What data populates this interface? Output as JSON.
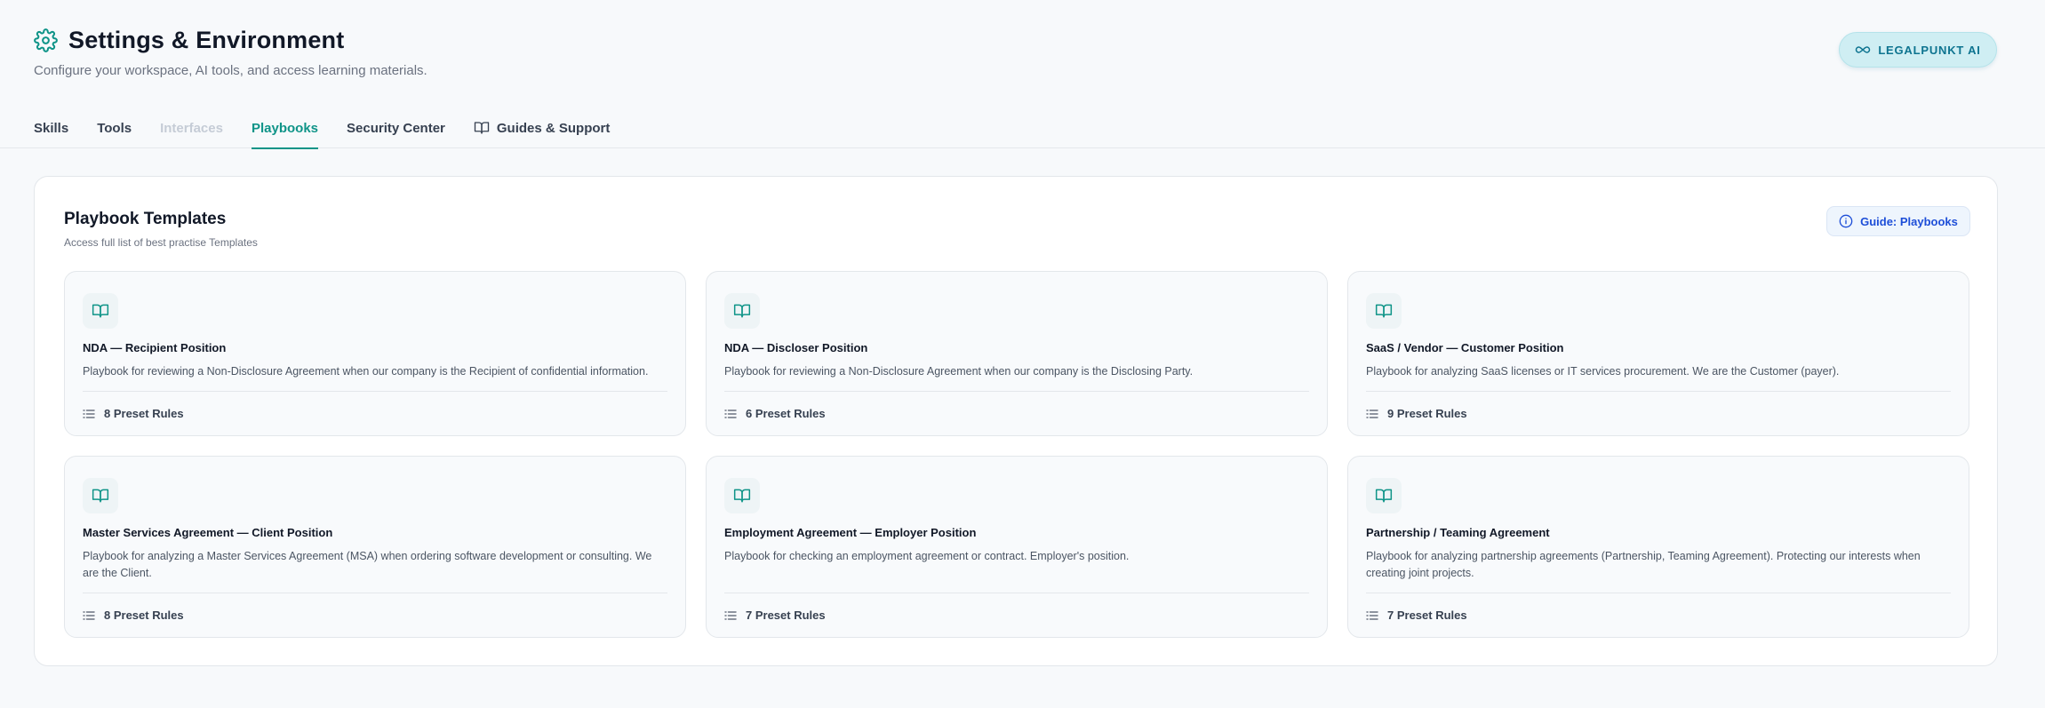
{
  "header": {
    "title": "Settings & Environment",
    "subtitle": "Configure your workspace, AI tools, and access learning materials.",
    "brand_button": "LEGALPUNKT AI"
  },
  "tabs": [
    {
      "label": "Skills",
      "state": "normal"
    },
    {
      "label": "Tools",
      "state": "normal"
    },
    {
      "label": "Interfaces",
      "state": "disabled"
    },
    {
      "label": "Playbooks",
      "state": "active"
    },
    {
      "label": "Security Center",
      "state": "normal"
    },
    {
      "label": "Guides & Support",
      "state": "normal",
      "icon": "book-icon"
    }
  ],
  "panel": {
    "title": "Playbook Templates",
    "subtitle": "Access full list of best practise Templates",
    "guide_button": "Guide: Playbooks"
  },
  "cards": [
    {
      "title": "NDA — Recipient Position",
      "description": "Playbook for reviewing a Non-Disclosure Agreement when our company is the Recipient of confidential information.",
      "rules": "8 Preset Rules"
    },
    {
      "title": "NDA — Discloser Position",
      "description": "Playbook for reviewing a Non-Disclosure Agreement when our company is the Disclosing Party.",
      "rules": "6 Preset Rules"
    },
    {
      "title": "SaaS / Vendor — Customer Position",
      "description": "Playbook for analyzing SaaS licenses or IT services procurement. We are the Customer (payer).",
      "rules": "9 Preset Rules"
    },
    {
      "title": "Master Services Agreement — Client Position",
      "description": "Playbook for analyzing a Master Services Agreement (MSA) when ordering software development or consulting. We are the Client.",
      "rules": "8 Preset Rules"
    },
    {
      "title": "Employment Agreement — Employer Position",
      "description": "Playbook for checking an employment agreement or contract. Employer's position.",
      "rules": "7 Preset Rules"
    },
    {
      "title": "Partnership / Teaming Agreement",
      "description": "Playbook for analyzing partnership agreements (Partnership, Teaming Agreement). Protecting our interests when creating joint projects.",
      "rules": "7 Preset Rules"
    }
  ],
  "colors": {
    "accent": "#0f9488",
    "brand_bg": "#cfeef3",
    "brand_text": "#0e7490",
    "guide_text": "#1d4ed8"
  }
}
